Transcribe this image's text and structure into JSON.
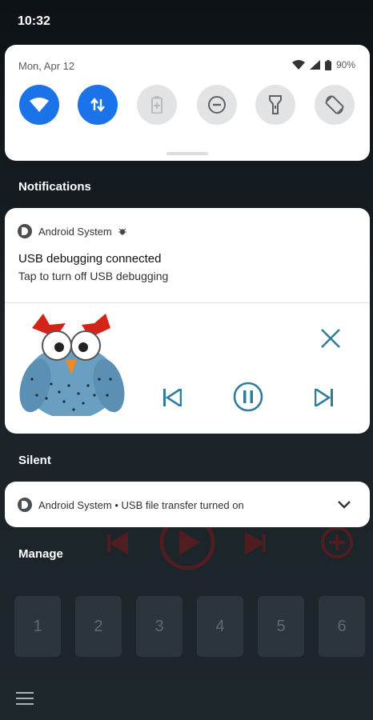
{
  "status_bar": {
    "time": "10:32"
  },
  "quick_settings": {
    "date": "Mon, Apr 12",
    "battery": "90%",
    "tiles": [
      {
        "name": "wifi",
        "state": "on"
      },
      {
        "name": "mobile-data",
        "state": "on"
      },
      {
        "name": "battery-saver",
        "state": "off"
      },
      {
        "name": "do-not-disturb",
        "state": "off"
      },
      {
        "name": "flashlight",
        "state": "off"
      },
      {
        "name": "auto-rotate",
        "state": "off"
      }
    ]
  },
  "sections": {
    "notifications": "Notifications",
    "silent": "Silent",
    "manage": "Manage"
  },
  "notification_usb": {
    "app": "Android System",
    "title": "USB debugging connected",
    "text": "Tap to turn off USB debugging"
  },
  "notification_silent": {
    "text": "Android System • USB file transfer turned on"
  },
  "background_keys": [
    "1",
    "2",
    "3",
    "4",
    "5",
    "6"
  ],
  "colors": {
    "accent": "#1a73e8",
    "media": "#2e7d9a",
    "background_red": "#7a1010"
  }
}
